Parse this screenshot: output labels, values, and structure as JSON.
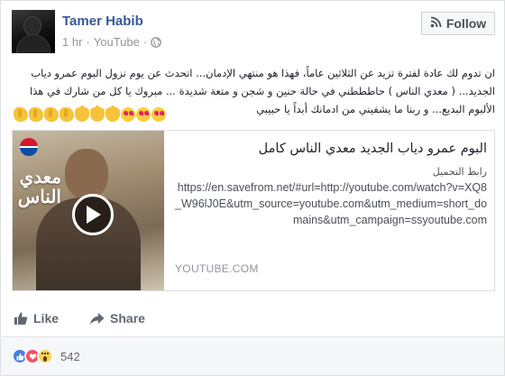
{
  "post": {
    "author": "Tamer Habib",
    "time": "1 hr",
    "source": "YouTube",
    "separator": "·",
    "follow_label": "Follow",
    "text": "ان تدوم لك عادة لفترة تزيد عن الثلاثين عاماً، فهذا هو منتهي الإدمان... اتحدث عن يوم نزول البوم عمرو دياب الجديد... ( معدي الناس ) حاطططني في حالة حنين و شجن و متعة شديدة ... مبروك يا كل من شارك في هذا الألبوم البديع... و ربنا ما يشفيني من ادمانك أبداً يا حبيبي"
  },
  "emojis": [
    "clap",
    "clap",
    "clap",
    "clap",
    "point",
    "point",
    "point",
    "heart-eyes",
    "heart-eyes",
    "heart-eyes"
  ],
  "link": {
    "thumbnail_text": "معدي الناس",
    "title": "البوم عمرو دياب الجديد معدي الناس كامل",
    "desc_label": "رابط التحميل",
    "url": "https://en.savefrom.net/#url=http://youtube.com/watch?v=XQ8_W96lJ0E&utm_source=youtube.com&utm_medium=short_domains&utm_campaign=ssyoutube.com",
    "domain": "YOUTUBE.COM"
  },
  "actions": {
    "like_label": "Like",
    "share_label": "Share"
  },
  "reactions": {
    "types": [
      "like",
      "love",
      "wow"
    ],
    "count": "542"
  },
  "colors": {
    "name": "#365899",
    "meta": "#90949c",
    "like_reaction": "#4a7fdb",
    "love_reaction": "#f25268",
    "wow_reaction": "#fcd34f"
  }
}
